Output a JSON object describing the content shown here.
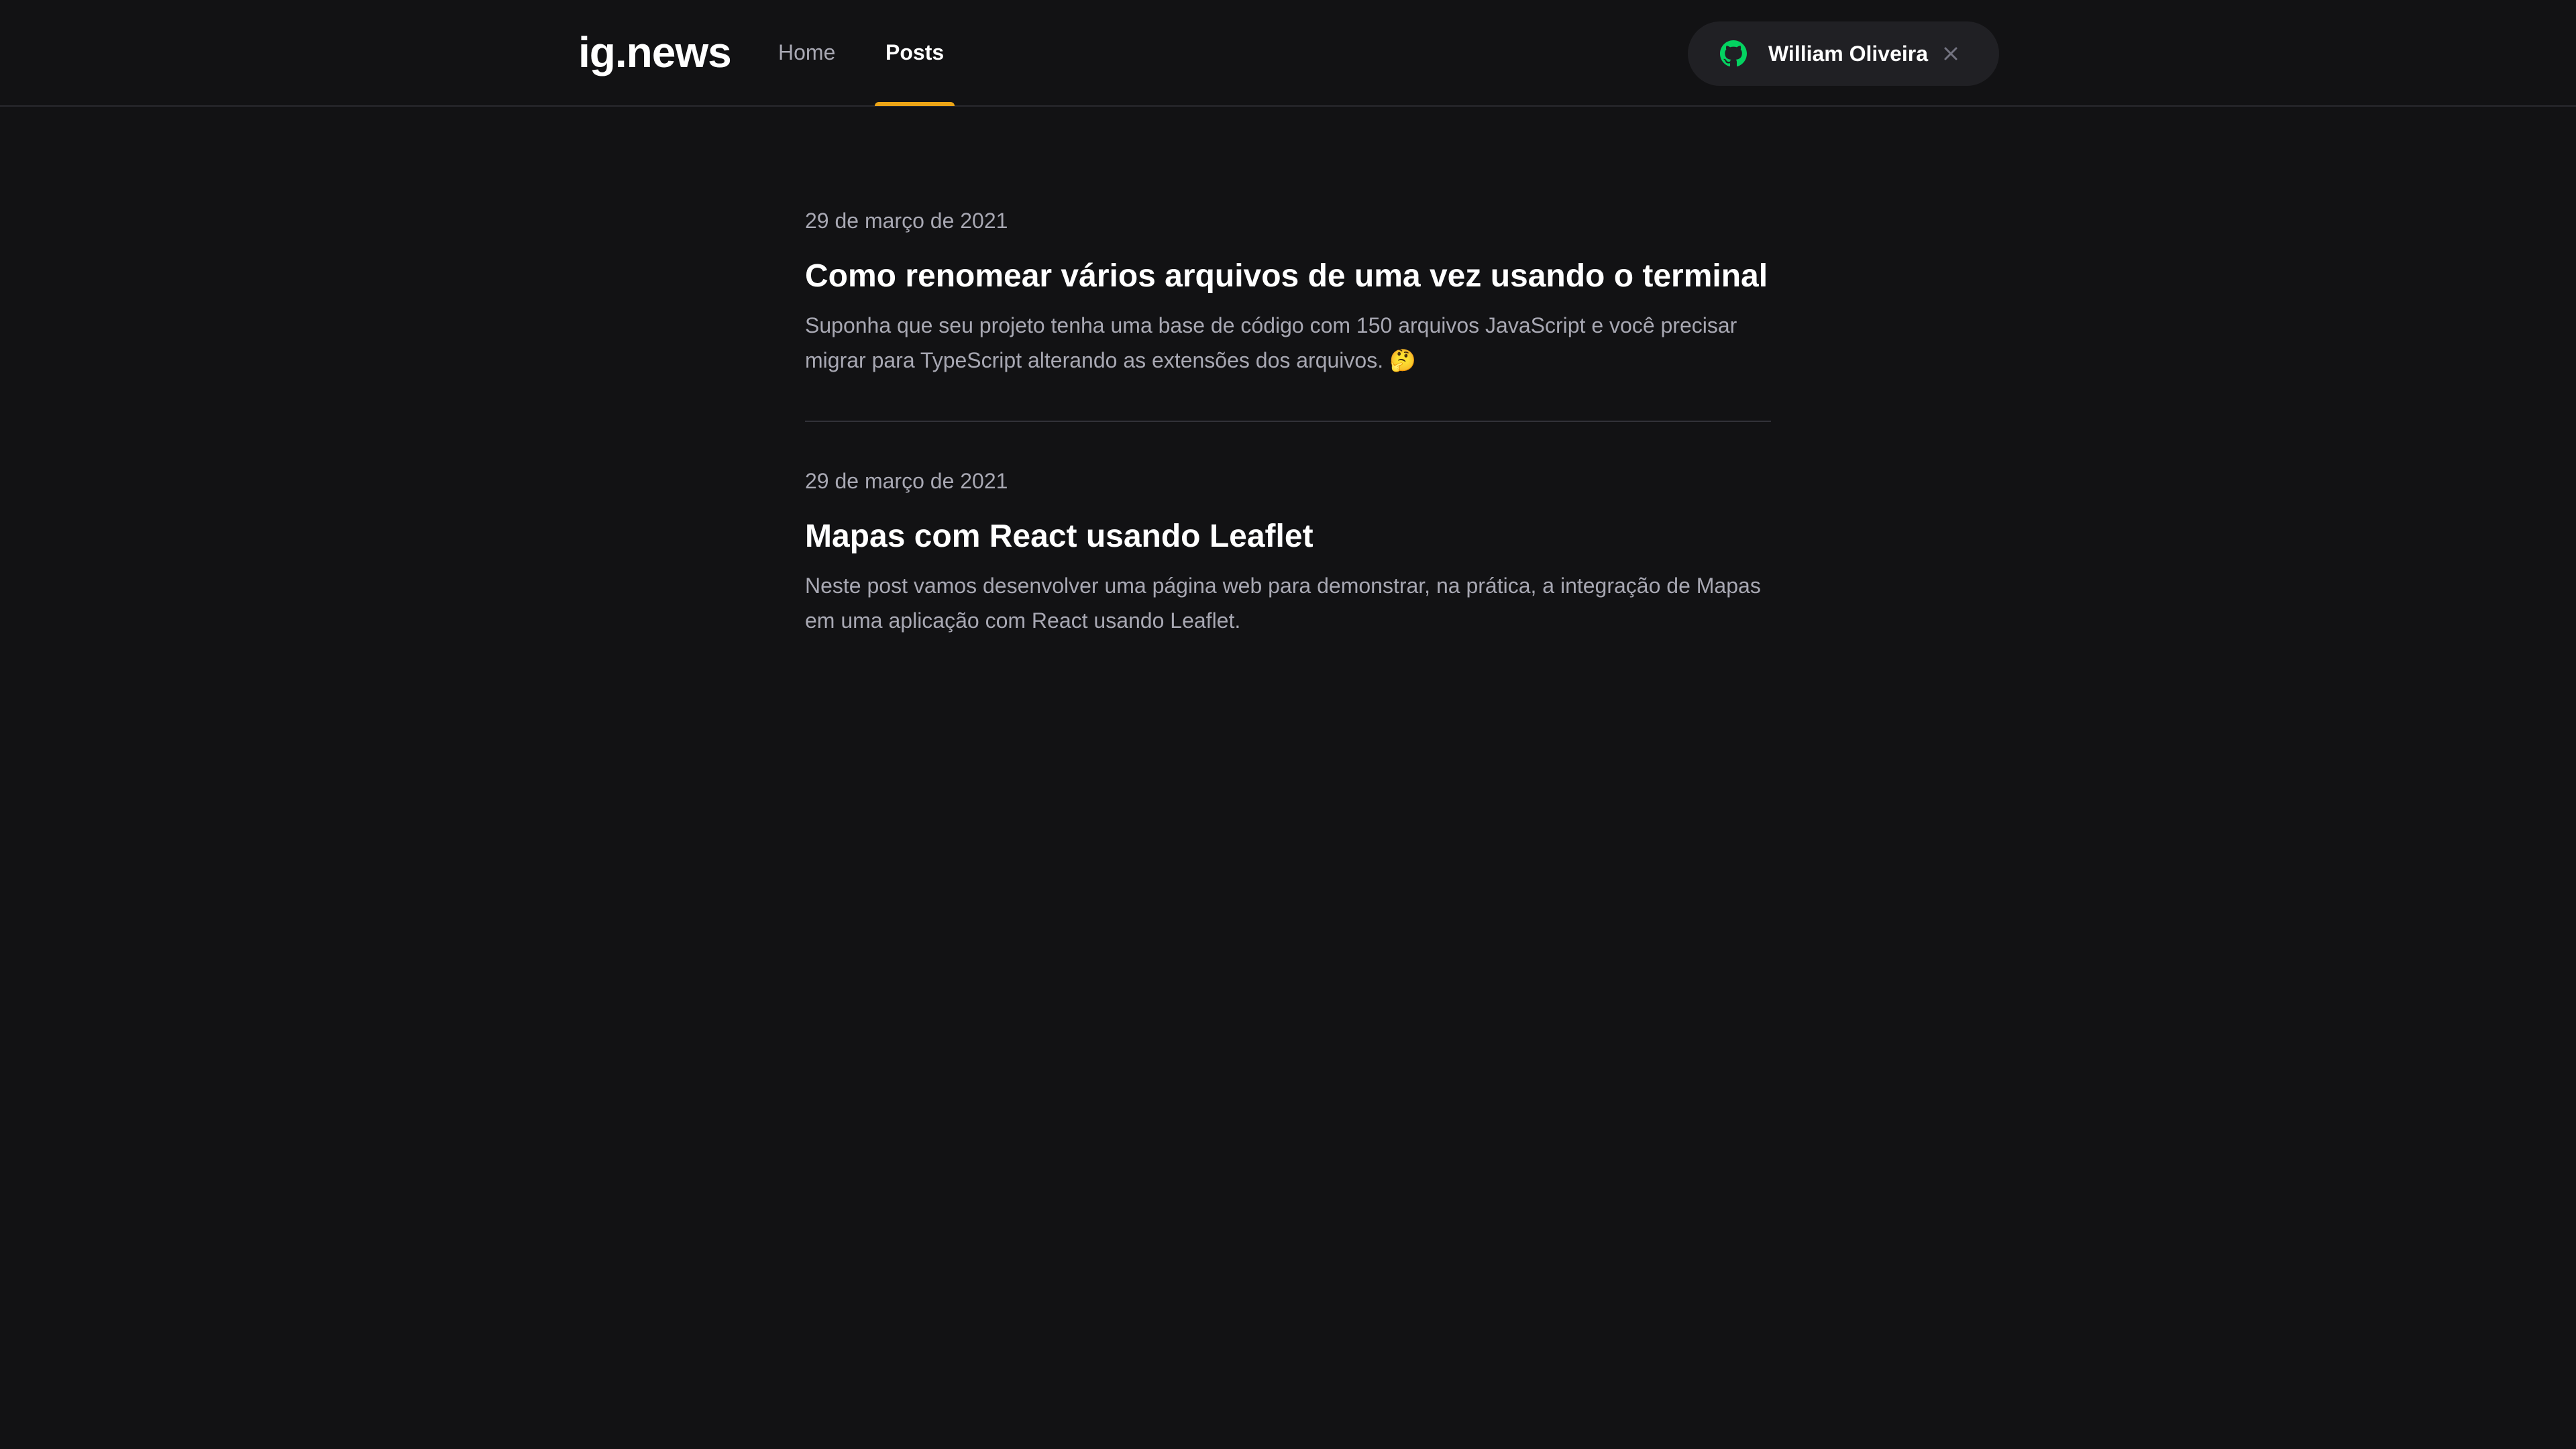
{
  "header": {
    "logo": "ig.news",
    "nav": [
      {
        "label": "Home",
        "active": false
      },
      {
        "label": "Posts",
        "active": true
      }
    ],
    "user_button": {
      "name": "William Oliveira",
      "leading_icon": "github-icon",
      "trailing_icon": "close-icon"
    }
  },
  "posts": [
    {
      "date": "29 de março de 2021",
      "title": "Como renomear vários arquivos de uma vez usando o terminal",
      "excerpt": "Suponha que seu projeto tenha uma base de código com 150 arquivos JavaScript e você precisar migrar para TypeScript alterando as extensões dos arquivos. 🤔"
    },
    {
      "date": "29 de março de 2021",
      "title": "Mapas com React usando Leaflet",
      "excerpt": "Neste post vamos desenvolver uma página web para demonstrar, na prática, a integração de Mapas em uma aplicação com React usando Leaflet."
    }
  ],
  "colors": {
    "background": "#121214",
    "accent": "#eba417",
    "github_green": "#04d361",
    "muted_text": "#a8a8b3",
    "button_bg": "#202024"
  }
}
